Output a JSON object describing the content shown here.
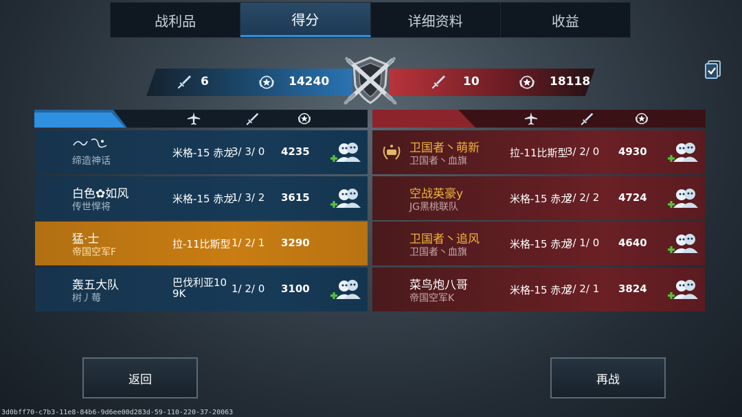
{
  "tabs": [
    {
      "label": "战利品"
    },
    {
      "label": "得分"
    },
    {
      "label": "详细资料"
    },
    {
      "label": "收益"
    }
  ],
  "scoreboard": {
    "blue_kills": "6",
    "blue_points": "14240",
    "red_kills": "10",
    "red_points": "18118"
  },
  "blue_team": [
    {
      "name": "",
      "clan": "缔造神话",
      "plane": "米格-15 赤龙",
      "kda": "3/ 3/ 0",
      "points": "4235"
    },
    {
      "name": "白色✿如风",
      "clan": "传世悍将",
      "plane": "米格-15 赤龙",
      "kda": "1/ 3/ 2",
      "points": "3615"
    },
    {
      "name": "猛·士",
      "clan": "帝国空军F",
      "plane": "拉-11比斯型",
      "kda": "1/ 2/ 1",
      "points": "3290"
    },
    {
      "name": "轰五大队",
      "clan": "树丿莓",
      "plane_line1": "巴伐利亚10",
      "plane_line2": "9K",
      "kda": "1/ 2/ 0",
      "points": "3100"
    }
  ],
  "red_team": [
    {
      "name": "卫国者丶萌新",
      "clan": "卫国者丶血旗",
      "plane": "拉-11比斯型",
      "kda": "3/ 2/ 0",
      "points": "4930"
    },
    {
      "name": "空战英豪y",
      "clan": "JG黑桃联队",
      "plane": "米格-15 赤龙",
      "kda": "2/ 2/ 2",
      "points": "4724"
    },
    {
      "name": "卫国者丶追风",
      "clan": "卫国者丶血旗",
      "plane": "米格-15 赤龙",
      "kda": "3/ 1/ 0",
      "points": "4640"
    },
    {
      "name": "菜鸟炮八哥",
      "clan": "帝国空军K",
      "plane": "米格-15 赤龙",
      "kda": "2/ 2/ 1",
      "points": "3824"
    }
  ],
  "buttons": {
    "back": "返回",
    "rematch": "再战"
  },
  "footer_id": "3d0bff70-c7b3-11e8-84b6-9d6ee00d283d-59-110-220-37-20063",
  "colors": {
    "blue_accent": "#2f8fe0",
    "red_accent": "#b8343a",
    "self_highlight": "#c97d12",
    "gold_name": "#f0b43c"
  },
  "icons": [
    "sword-icon",
    "star-medal-icon",
    "plane-icon",
    "add-friend-icon",
    "crossed-swords-emblem-icon",
    "clipboard-check-icon"
  ]
}
